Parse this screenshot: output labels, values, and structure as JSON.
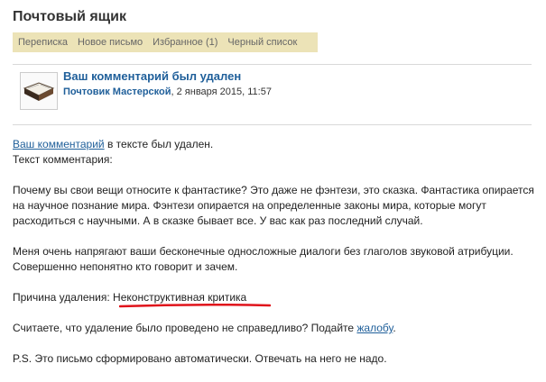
{
  "page": {
    "title": "Почтовый ящик"
  },
  "tabs": [
    {
      "label": "Переписка"
    },
    {
      "label": "Новое письмо"
    },
    {
      "label": "Избранное (1)"
    },
    {
      "label": "Черный список"
    }
  ],
  "message": {
    "subject": "Ваш комментарий был удален",
    "author": "Почтовик Мастерской",
    "date": ", 2 января 2015, 11:57"
  },
  "body": {
    "line1_link": "Ваш комментарий",
    "line1_rest": " в тексте был удален.",
    "line2": "Текст комментария:",
    "para1": "Почему вы свои вещи относите к фантастике? Это даже не фэнтези, это сказка. Фантастика опирается на научное познание мира. Фэнтези опирается на определенные законы мира, которые могут расходиться с научными. А в сказке бывает все. У вас как раз последний случай.",
    "para2": "Меня очень напрягают ваши бесконечные односложные диалоги без глаголов звуковой атрибуции. Совершенно непонятно кто говорит и зачем.",
    "reason": "Причина удаления: Неконструктивная критика",
    "appeal_prefix": "Считаете, что удаление было проведено не справедливо? Подайте ",
    "appeal_link": "жалобу",
    "appeal_suffix": ".",
    "ps": "P.S. Это письмо сформировано автоматически. Отвечать на него не надо."
  },
  "colors": {
    "link": "#1f5f9a",
    "tabs_bg": "#ece3b7",
    "underline": "#e0131b"
  }
}
